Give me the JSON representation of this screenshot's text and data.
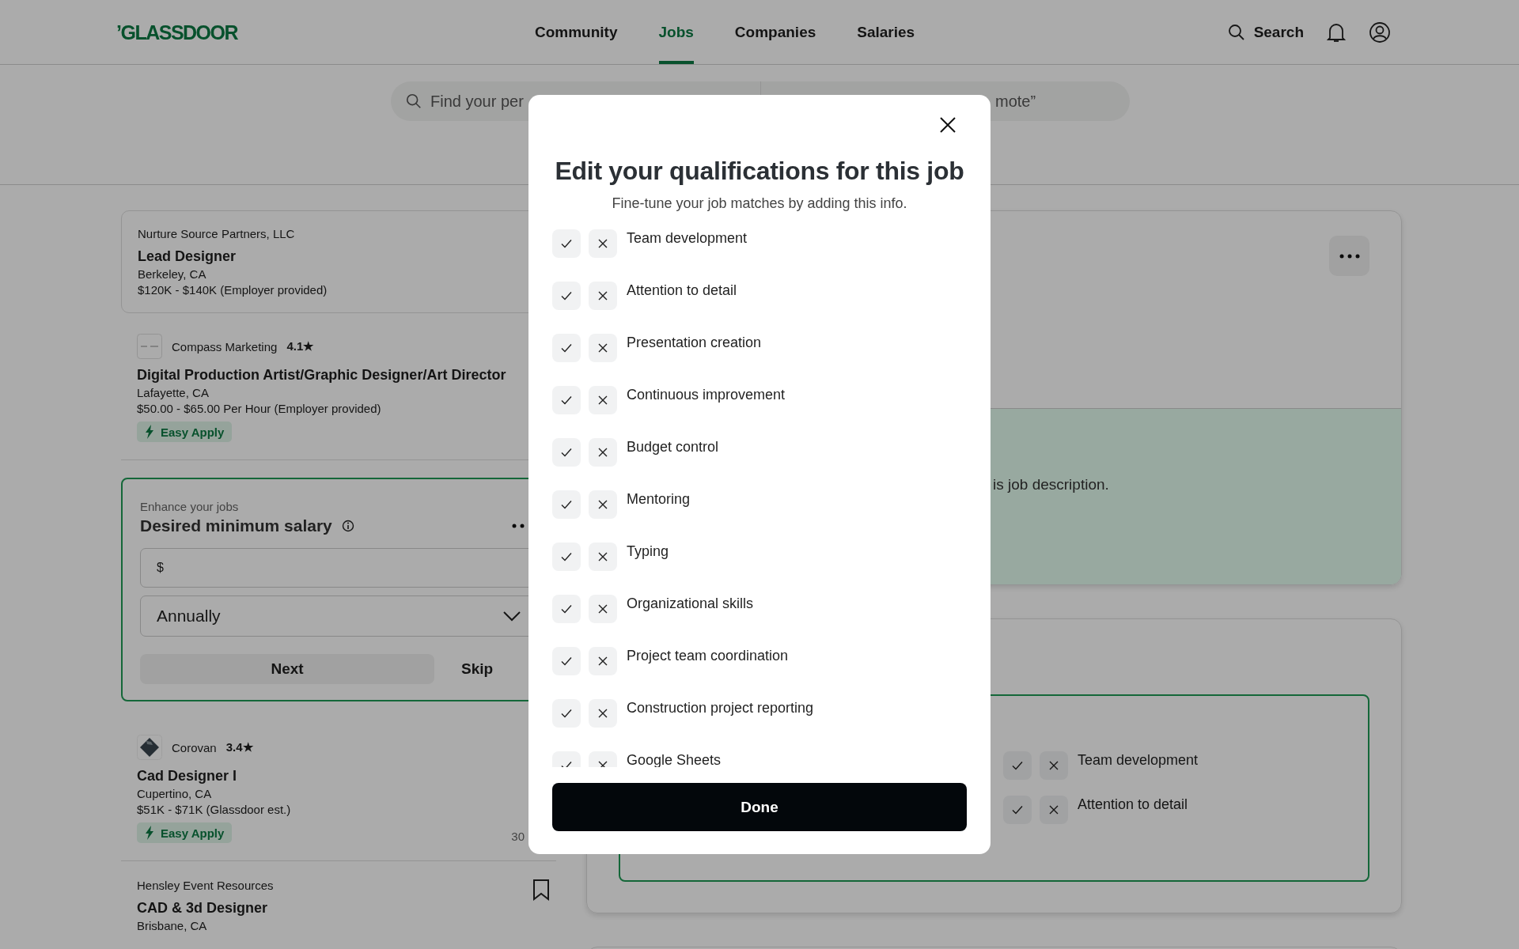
{
  "header": {
    "logo": "’GLASSDOOR",
    "nav": [
      {
        "label": "Community",
        "selected": false
      },
      {
        "label": "Jobs",
        "selected": true
      },
      {
        "label": "Companies",
        "selected": false
      },
      {
        "label": "Salaries",
        "selected": false
      }
    ],
    "search_label": "Search"
  },
  "search": {
    "keyword_placeholder": "Find your per",
    "location_placeholder": "mote”"
  },
  "jobs": [
    {
      "kind": "job",
      "selected": true,
      "company": "Nurture Source Partners, LLC",
      "title": "Lead Designer",
      "location": "Berkeley, CA",
      "salary": "$120K - $140K (Employer provided)"
    },
    {
      "kind": "job",
      "selected": false,
      "logo": {
        "kind": "tile"
      },
      "company": "Compass Marketing",
      "rating": "4.1★",
      "title": "Digital Production Artist/Graphic Designer/Art Director",
      "location": "Lafayette, CA",
      "salary": "$50.00 - $65.00 Per Hour (Employer provided)",
      "badge": "Easy Apply"
    },
    {
      "kind": "salary_prompt",
      "eyebrow": "Enhance your jobs",
      "title": "Desired minimum salary",
      "currency": "$",
      "frequency": "Annually",
      "buttons": [
        "Next",
        "Skip"
      ]
    },
    {
      "kind": "job",
      "selected": false,
      "logo": {
        "kind": "diamond"
      },
      "company": "Corovan",
      "rating": "3.4★",
      "title": "Cad Designer I",
      "location": "Cupertino, CA",
      "salary": "$51K - $71K (Glassdoor est.)",
      "badge": "Easy Apply",
      "age": "30"
    },
    {
      "kind": "job",
      "selected": false,
      "company": "Hensley Event Resources",
      "title": "CAD & 3d Designer",
      "location": "Brisbane, CA",
      "saved": false
    }
  ],
  "detail": {
    "description_fragment": "is job description.",
    "qualifications": [
      "Team development",
      "Attention to detail"
    ]
  },
  "modal": {
    "title": "Edit your qualifications for this job",
    "subtitle": "Fine-tune your job matches by adding this info.",
    "qualifications": [
      "Team development",
      "Attention to detail",
      "Presentation creation",
      "Continuous improvement",
      "Budget control",
      "Mentoring",
      "Typing",
      "Organizational skills",
      "Project team coordination",
      "Construction project reporting",
      "Google Sheets"
    ],
    "done": "Done"
  }
}
